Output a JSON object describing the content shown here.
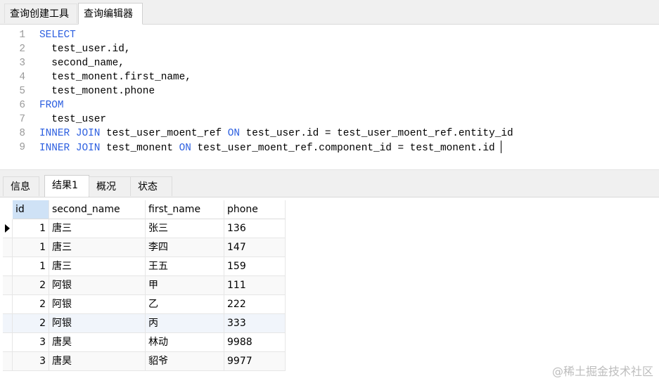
{
  "top_tabs": [
    "查询创建工具",
    "查询编辑器"
  ],
  "editor": {
    "lines": [
      {
        "n": "1",
        "parts": [
          {
            "t": "SELECT",
            "kw": true
          }
        ]
      },
      {
        "n": "2",
        "parts": [
          {
            "t": "  test_user.id,",
            "kw": false
          }
        ]
      },
      {
        "n": "3",
        "parts": [
          {
            "t": "  second_name,",
            "kw": false
          }
        ]
      },
      {
        "n": "4",
        "parts": [
          {
            "t": "  test_monent.first_name,",
            "kw": false
          }
        ]
      },
      {
        "n": "5",
        "parts": [
          {
            "t": "  test_monent.phone",
            "kw": false
          }
        ]
      },
      {
        "n": "6",
        "parts": [
          {
            "t": "FROM",
            "kw": true
          }
        ]
      },
      {
        "n": "7",
        "parts": [
          {
            "t": "  test_user",
            "kw": false
          }
        ]
      },
      {
        "n": "8",
        "parts": [
          {
            "t": "INNER JOIN",
            "kw": true
          },
          {
            "t": " test_user_moent_ref ",
            "kw": false
          },
          {
            "t": "ON",
            "kw": true
          },
          {
            "t": " test_user.id = test_user_moent_ref.entity_id",
            "kw": false
          }
        ]
      },
      {
        "n": "9",
        "parts": [
          {
            "t": "INNER JOIN",
            "kw": true
          },
          {
            "t": " test_monent ",
            "kw": false
          },
          {
            "t": "ON",
            "kw": true
          },
          {
            "t": " test_user_moent_ref.component_id = test_monent.id",
            "kw": false
          }
        ]
      }
    ]
  },
  "result_tabs": [
    "信息",
    "结果1",
    "概况",
    "状态"
  ],
  "grid": {
    "columns": [
      "id",
      "second_name",
      "first_name",
      "phone"
    ],
    "rows": [
      [
        "1",
        "唐三",
        "张三",
        "136"
      ],
      [
        "1",
        "唐三",
        "李四",
        "147"
      ],
      [
        "1",
        "唐三",
        "王五",
        "159"
      ],
      [
        "2",
        "阿银",
        "甲",
        "111"
      ],
      [
        "2",
        "阿银",
        "乙",
        "222"
      ],
      [
        "2",
        "阿银",
        "丙",
        "333"
      ],
      [
        "3",
        "唐昊",
        "林动",
        "9988"
      ],
      [
        "3",
        "唐昊",
        "貂爷",
        "9977"
      ]
    ]
  },
  "watermark": "@稀土掘金技术社区"
}
